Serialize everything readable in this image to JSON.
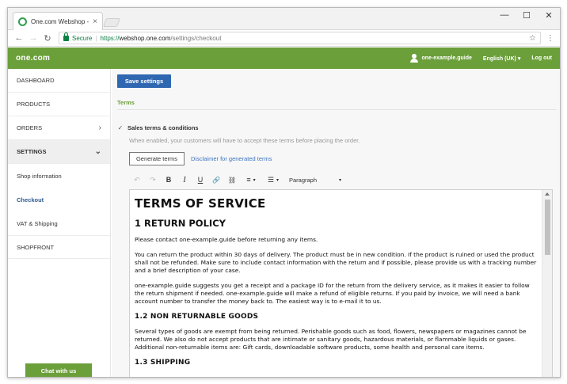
{
  "browser": {
    "tab_title": "One.com Webshop - Setti",
    "tab_close": "×",
    "window_controls": {
      "minimize": "—",
      "maximize": "☐",
      "close": "✕"
    },
    "back": "←",
    "forward": "→",
    "reload": "↻",
    "secure_label": "Secure",
    "url_proto": "https://",
    "url_host": "webshop.one.com",
    "url_path": "/settings/checkout",
    "star": "☆",
    "menu": "⋮"
  },
  "header": {
    "logo": "one.com",
    "user": "one-example.guide",
    "language": "English (UK) ▾",
    "logout": "Log out"
  },
  "sidebar": {
    "items": [
      {
        "label": "DASHBOARD"
      },
      {
        "label": "PRODUCTS"
      },
      {
        "label": "ORDERS",
        "chevron": "›"
      },
      {
        "label": "SETTINGS",
        "chevron": "⌄"
      }
    ],
    "sub_items": [
      {
        "label": "Shop information"
      },
      {
        "label": "Checkout"
      },
      {
        "label": "VAT & Shipping"
      }
    ],
    "storefront": "SHOPFRONT",
    "chat": "Chat with us"
  },
  "main": {
    "save_label": "Save settings",
    "section_title": "Terms",
    "checkbox_mark": "✓",
    "checkbox_label": "Sales terms & conditions",
    "hint": "When enabled, your customers will have to accept these terms before placing the order.",
    "generate_label": "Generate terms",
    "disclaimer_link": "Disclaimer for generated terms",
    "toolbar": {
      "undo": "↶",
      "redo": "↷",
      "bold": "B",
      "italic": "I",
      "underline": "U",
      "link": "🔗",
      "unlink": "⛓",
      "ordered_list": "≡",
      "bullet_list": "☰",
      "caret": "▾",
      "format": "Paragraph"
    }
  },
  "editor": {
    "h1": "TERMS OF SERVICE",
    "h2": "1 RETURN POLICY",
    "p1": "Please contact one-example.guide before returning any items.",
    "p2": "You can return the product within 30 days of delivery. The product must be in new condition. If the product is ruined or used the product shall not be refunded. Make sure to include contact information with the return and if possible, please provide us with a tracking number and a brief description of your case.",
    "p3": "one-example.guide suggests you get a receipt and a package ID for the return from the delivery service, as it makes it easier to follow the return shipment if needed. one-example.guide will make a refund of eligible returns. If you paid by invoice, we will need a bank account number to transfer the money back to. The easiest way is to e-mail it to us.",
    "h3a": "1.2 NON RETURNABLE GOODS",
    "p4": "Several types of goods are exempt from being returned. Perishable goods such as food, flowers, newspapers or magazines cannot be returned. We also do not accept products that are intimate or sanitary goods, hazardous materials, or flammable liquids or gases. Additional non-returnable items are: Gift cards, downloadable software products, some health and personal care items.",
    "h3b": "1.3 SHIPPING"
  },
  "colors": {
    "brand_green": "#6b9f3a",
    "primary_blue": "#2f67b1",
    "link_blue": "#3b74c3"
  }
}
